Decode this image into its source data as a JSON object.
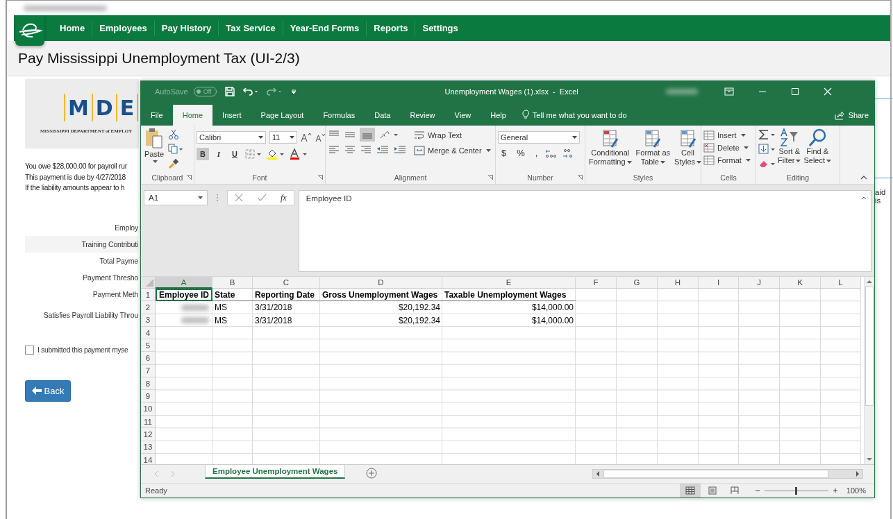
{
  "nav": {
    "items": [
      "Home",
      "Employees",
      "Pay History",
      "Tax Service",
      "Year-End Forms",
      "Reports",
      "Settings"
    ]
  },
  "page_title": "Pay Mississippi Unemployment Tax (UI-2/3)",
  "agency_logo": {
    "letters": [
      "M",
      "D",
      "E"
    ],
    "caption": "MISSISSIPPI DEPARTMENT of EMPLOY"
  },
  "notice_lines": [
    "You owe $28,000.00 for payroll rur",
    "This payment is due by 4/27/2018",
    "If the liability amounts appear to h"
  ],
  "side_text": "aid is",
  "form_labels": [
    {
      "text": "Employ",
      "shaded": false
    },
    {
      "text": "Training Contributi",
      "shaded": true
    },
    {
      "text": "Total Payme",
      "shaded": false
    },
    {
      "text": "Payment Thresho",
      "shaded": false
    },
    {
      "text": "Payment Meth",
      "shaded": false
    },
    {
      "text": "Satisfies Payroll Liability Throu",
      "shaded": false
    }
  ],
  "confirm_checkbox": {
    "label": "I submitted this payment myse",
    "checked": false
  },
  "back_button": {
    "label": "Back"
  },
  "excel": {
    "title": "Unemployment Wages (1).xlsx  -  Excel",
    "autosave": {
      "label": "AutoSave",
      "toggle": "Off",
      "on": false
    },
    "tabs": [
      {
        "label": "File",
        "selected": false
      },
      {
        "label": "Home",
        "selected": true
      },
      {
        "label": "Insert",
        "selected": false
      },
      {
        "label": "Page Layout",
        "selected": false
      },
      {
        "label": "Formulas",
        "selected": false
      },
      {
        "label": "Data",
        "selected": false
      },
      {
        "label": "Review",
        "selected": false
      },
      {
        "label": "View",
        "selected": false
      },
      {
        "label": "Help",
        "selected": false
      }
    ],
    "tell_me": "Tell me what you want to do",
    "share": "Share",
    "ribbon": {
      "paste": "Paste",
      "font_name": "Calibri",
      "font_size": "11",
      "style_buttons": [
        {
          "label": "B",
          "selected": true
        },
        {
          "label": "I",
          "selected": false
        },
        {
          "label": "U",
          "selected": false
        }
      ],
      "wrap_text": "Wrap Text",
      "merge_center": "Merge & Center",
      "number_format": "General",
      "number_buttons": [
        "$",
        "%",
        ","
      ],
      "styles": [
        {
          "lines": [
            "Conditional",
            "Formatting"
          ]
        },
        {
          "lines": [
            "Format as",
            "Table"
          ]
        },
        {
          "lines": [
            "Cell",
            "Styles"
          ]
        }
      ],
      "cells": [
        "Insert",
        "Delete",
        "Format"
      ],
      "editing": [
        {
          "lines": [
            "Sort &",
            "Filter"
          ]
        },
        {
          "lines": [
            "Find &",
            "Select"
          ]
        }
      ],
      "groups": [
        "Clipboard",
        "Font",
        "Alignment",
        "Number",
        "Styles",
        "Cells",
        "Editing"
      ]
    },
    "name_box": "A1",
    "fx": "fx",
    "formula": "Employee ID",
    "columns": [
      {
        "label": "A",
        "selected": true
      },
      {
        "label": "B",
        "selected": false
      },
      {
        "label": "C",
        "selected": false
      },
      {
        "label": "D",
        "selected": false
      },
      {
        "label": "E",
        "selected": false
      },
      {
        "label": "F",
        "selected": false
      },
      {
        "label": "G",
        "selected": false
      },
      {
        "label": "H",
        "selected": false
      },
      {
        "label": "I",
        "selected": false
      },
      {
        "label": "J",
        "selected": false
      },
      {
        "label": "K",
        "selected": false
      },
      {
        "label": "L",
        "selected": false
      }
    ],
    "header_row": {
      "number": "1",
      "cells": [
        {
          "text": "Employee ID",
          "selected": true
        },
        {
          "text": "State",
          "selected": false
        },
        {
          "text": "Reporting Date",
          "selected": false
        },
        {
          "text": "Gross Unemployment Wages",
          "selected": false
        },
        {
          "text": "Taxable Unemployment  Wages",
          "selected": false
        }
      ]
    },
    "rows": [
      {
        "number": "2",
        "cells": [
          {
            "kind": "redacted"
          },
          {
            "kind": "text",
            "text": "MS"
          },
          {
            "kind": "text",
            "text": "3/31/2018"
          },
          {
            "kind": "currency",
            "text": "$20,192.34"
          },
          {
            "kind": "currency",
            "text": "$14,000.00"
          }
        ]
      },
      {
        "number": "3",
        "cells": [
          {
            "kind": "redacted"
          },
          {
            "kind": "text",
            "text": "MS"
          },
          {
            "kind": "text",
            "text": "3/31/2018"
          },
          {
            "kind": "currency",
            "text": "$20,192.34"
          },
          {
            "kind": "currency",
            "text": "$14,000.00"
          }
        ]
      },
      {
        "number": "4",
        "cells": []
      },
      {
        "number": "5",
        "cells": []
      },
      {
        "number": "6",
        "cells": []
      },
      {
        "number": "7",
        "cells": []
      },
      {
        "number": "8",
        "cells": []
      },
      {
        "number": "9",
        "cells": []
      },
      {
        "number": "10",
        "cells": []
      },
      {
        "number": "11",
        "cells": []
      },
      {
        "number": "12",
        "cells": []
      },
      {
        "number": "13",
        "cells": []
      },
      {
        "number": "14",
        "cells": []
      }
    ],
    "sheet_tabs": [
      {
        "label": "Employee Unemployment Wages",
        "selected": true
      }
    ],
    "status": "Ready",
    "views": [
      {
        "kind": "normal",
        "selected": true
      },
      {
        "kind": "page-layout",
        "selected": false
      },
      {
        "kind": "page-break",
        "selected": false
      }
    ],
    "zoom": {
      "level": 0.5,
      "reading": "100%"
    }
  }
}
